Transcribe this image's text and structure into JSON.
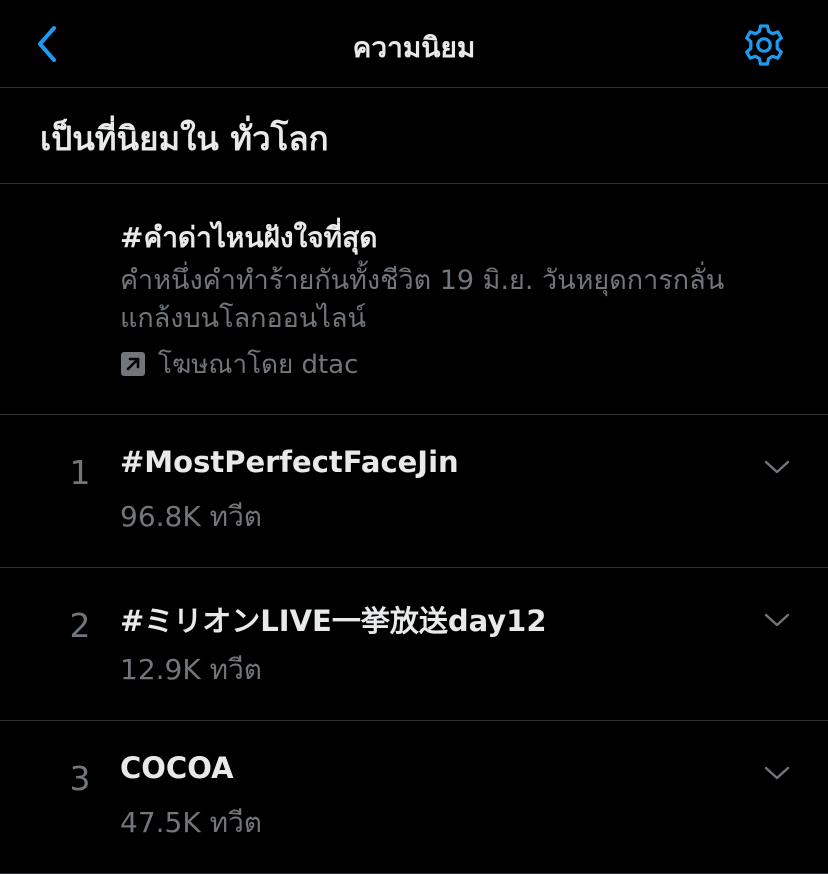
{
  "nav": {
    "title": "ความนิยม",
    "back_icon": "chevron-left-icon",
    "settings_icon": "gear-icon"
  },
  "section": {
    "title": "เป็นที่นิยมใน ทั่วโลก"
  },
  "promoted": {
    "hashtag": "#คำด่าไหนฝังใจที่สุด",
    "description": "คำหนึ่งคำทำร้ายกันทั้งชีวิต 19 มิ.ย. วันหยุดการกลั่นแกล้งบนโลกออนไลน์",
    "promoted_label": "โฆษณาโดย dtac",
    "promoted_icon": "promoted-arrow-icon"
  },
  "trends": [
    {
      "rank": "1",
      "name": "#MostPerfectFaceJin",
      "count": "96.8K ทวีต"
    },
    {
      "rank": "2",
      "name": "#ミリオンLIVE一挙放送day12",
      "count": "12.9K ทวีต"
    },
    {
      "rank": "3",
      "name": "COCOA",
      "count": "47.5K ทวีต"
    }
  ],
  "colors": {
    "background": "#000000",
    "accent": "#1d9bf0",
    "primary_text": "#e7e9ea",
    "secondary_text": "#71767b",
    "divider": "#2f3336"
  }
}
